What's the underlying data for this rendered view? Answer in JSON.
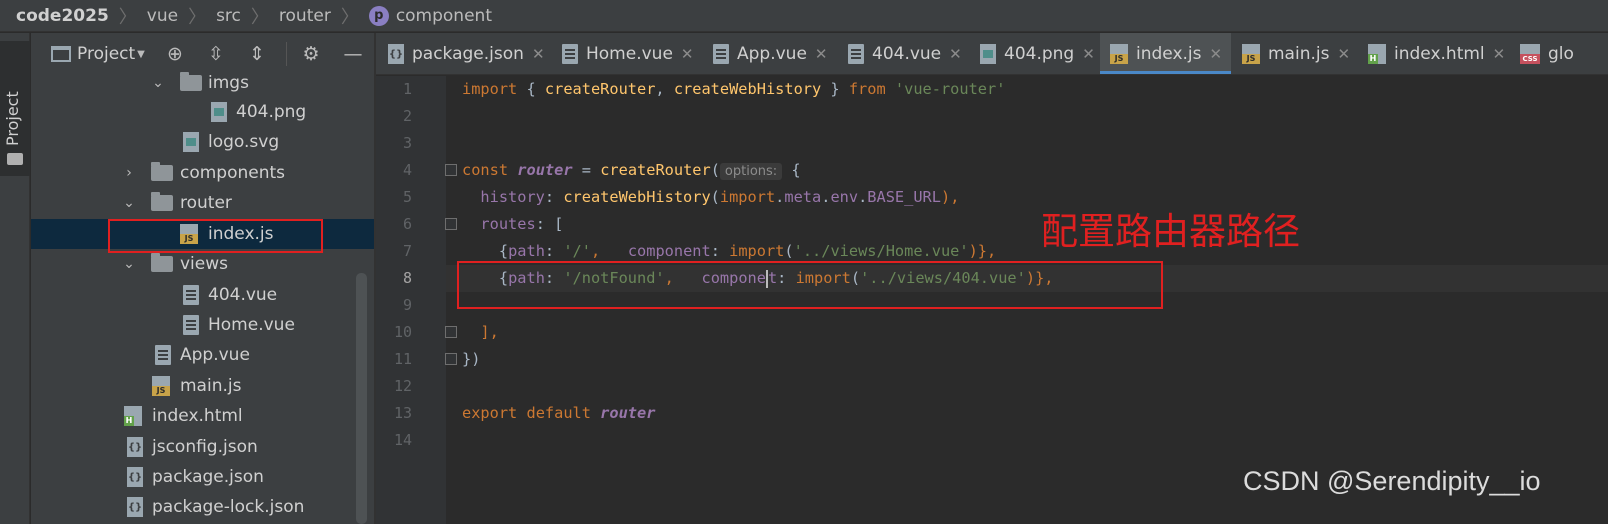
{
  "breadcrumb": [
    "code2025",
    "vue",
    "src",
    "router",
    "component"
  ],
  "breadcrumb_badge": "p",
  "toolstrip": {
    "project_label": "Project"
  },
  "panel": {
    "title": "Project"
  },
  "tree": [
    {
      "label": "imgs",
      "type": "folder",
      "expanded": true
    },
    {
      "label": "404.png",
      "type": "image"
    },
    {
      "label": "logo.svg",
      "type": "image"
    },
    {
      "label": "components",
      "type": "folder",
      "expanded": false
    },
    {
      "label": "router",
      "type": "folder",
      "expanded": true
    },
    {
      "label": "index.js",
      "type": "js",
      "selected": true
    },
    {
      "label": "views",
      "type": "folder",
      "expanded": true
    },
    {
      "label": "404.vue",
      "type": "file"
    },
    {
      "label": "Home.vue",
      "type": "file"
    },
    {
      "label": "App.vue",
      "type": "file"
    },
    {
      "label": "main.js",
      "type": "js"
    },
    {
      "label": "index.html",
      "type": "html"
    },
    {
      "label": "jsconfig.json",
      "type": "json"
    },
    {
      "label": "package.json",
      "type": "json"
    },
    {
      "label": "package-lock.json",
      "type": "json"
    }
  ],
  "tabs": [
    {
      "label": "package.json"
    },
    {
      "label": "Home.vue"
    },
    {
      "label": "App.vue"
    },
    {
      "label": "404.vue"
    },
    {
      "label": "404.png"
    },
    {
      "label": "index.js",
      "active": true
    },
    {
      "label": "main.js"
    },
    {
      "label": "index.html"
    },
    {
      "label": "glo"
    }
  ],
  "icon_text": {
    "js": "JS",
    "html": "H",
    "css": "CSS",
    "json": "{}"
  },
  "editor": {
    "line_numbers": [
      "1",
      "2",
      "3",
      "4",
      "5",
      "6",
      "7",
      "8",
      "9",
      "10",
      "11",
      "12",
      "13",
      "14"
    ],
    "current_line": "8",
    "code": {
      "l1_a": "import",
      "l1_b": " { ",
      "l1_c": "createRouter",
      "l1_d": ", ",
      "l1_e": "createWebHistory",
      "l1_f": " } ",
      "l1_g": "from",
      "l1_h": " ",
      "l1_i": "'vue-router'",
      "l4_a": "const",
      "l4_b": " ",
      "l4_c": "router",
      "l4_d": " = ",
      "l4_e": "createRouter",
      "l4_f": "(",
      "l4_hint": "options:",
      "l4_g": " {",
      "l5_a": "  ",
      "l5_b": "history",
      "l5_c": ": ",
      "l5_d": "createWebHistory",
      "l5_e": "(",
      "l5_f": "import",
      "l5_g": ".",
      "l5_h": "meta",
      "l5_i": ".",
      "l5_j": "env",
      "l5_k": ".",
      "l5_l": "BASE_URL",
      "l5_m": "),",
      "l6_a": "  ",
      "l6_b": "routes",
      "l6_c": ": [",
      "l7_a": "    {",
      "l7_b": "path",
      "l7_c": ": ",
      "l7_d": "'/'",
      "l7_e": ",   ",
      "l7_f": "component",
      "l7_g": ": ",
      "l7_h": "import",
      "l7_i": "(",
      "l7_j": "'../views/Home.vue'",
      "l7_k": ")},",
      "l8_a": "    {",
      "l8_b": "path",
      "l8_c": ": ",
      "l8_d": "'/notFound'",
      "l8_e": ",   ",
      "l8_f1": "compone",
      "l8_f2": "t",
      "l8_g": ": ",
      "l8_h": "import",
      "l8_i": "(",
      "l8_j": "'../views/404.vue'",
      "l8_k": ")},",
      "l10_a": "  ],",
      "l11_a": "})",
      "l13_a": "export",
      "l13_b": " ",
      "l13_c": "default",
      "l13_d": " ",
      "l13_e": "router"
    }
  },
  "annotation": "配置路由器路径",
  "watermark": "CSDN @Serendipity__io",
  "colors": {
    "accent": "#4a88c7",
    "annotation_red": "#e02020"
  }
}
